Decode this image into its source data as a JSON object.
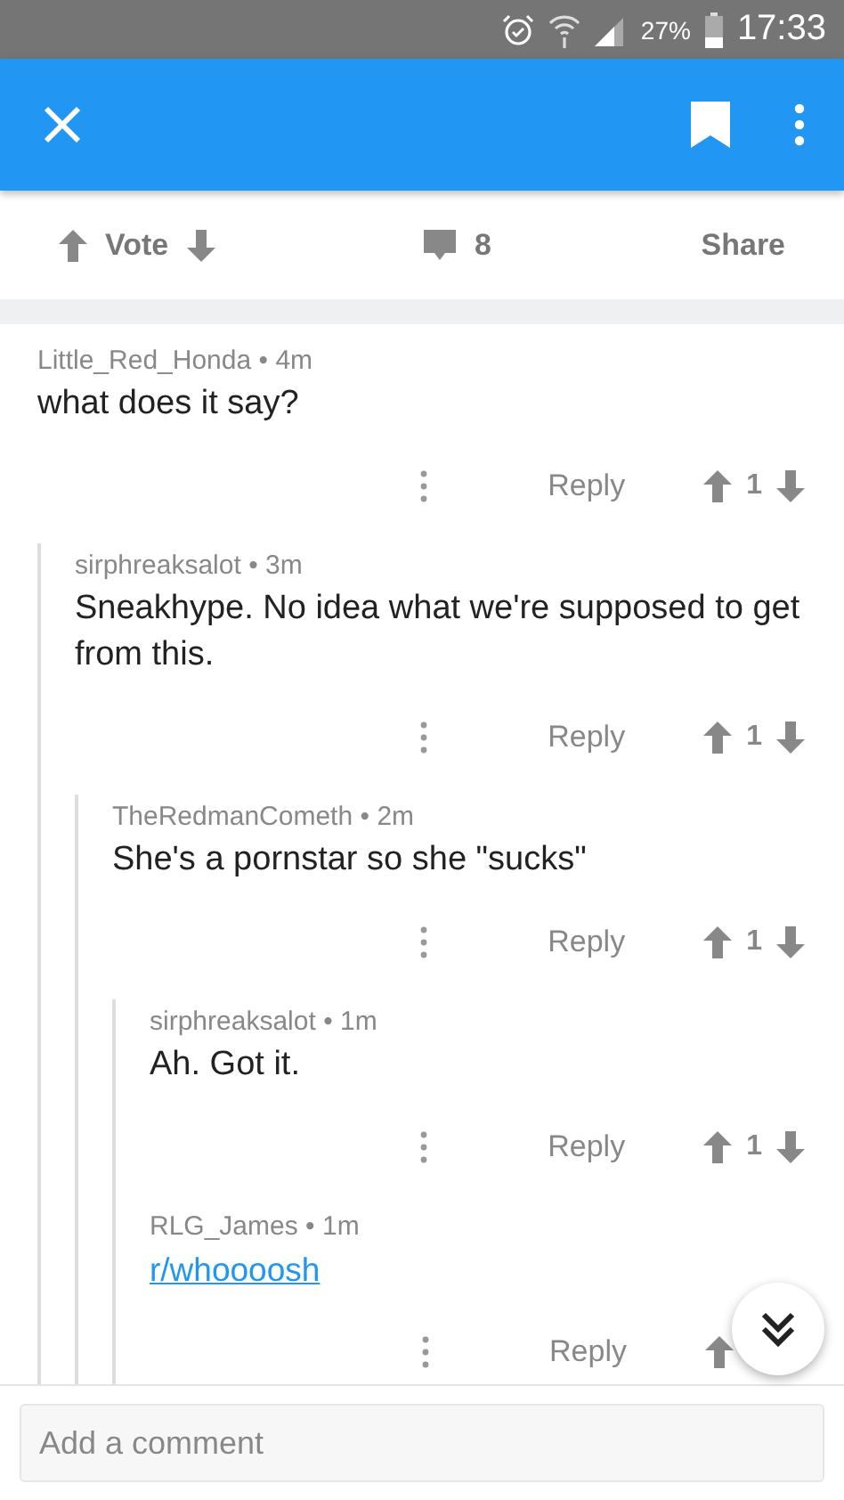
{
  "status_bar": {
    "battery": "27%",
    "time": "17:33"
  },
  "meta_separator": "•",
  "post_actions": {
    "vote_label": "Vote",
    "comment_count": "8",
    "share_label": "Share"
  },
  "comments": [
    {
      "author": "Little_Red_Honda",
      "age": "4m",
      "body": "what does it say?",
      "kind": "text",
      "reply_label": "Reply",
      "score": "1",
      "children": [
        {
          "author": "sirphreaksalot",
          "age": "3m",
          "body": "Sneakhype. No idea what we're supposed to get from this.",
          "kind": "text",
          "reply_label": "Reply",
          "score": "1",
          "children": [
            {
              "author": "TheRedmanCometh",
              "age": "2m",
              "body": "She's a pornstar so she \"sucks\"",
              "kind": "text",
              "reply_label": "Reply",
              "score": "1",
              "children": [
                {
                  "author": "sirphreaksalot",
                  "age": "1m",
                  "body": "Ah. Got it.",
                  "kind": "text",
                  "reply_label": "Reply",
                  "score": "1"
                },
                {
                  "author": "RLG_James",
                  "age": "1m",
                  "body": "r/whoooosh",
                  "kind": "link",
                  "reply_label": "Reply"
                }
              ]
            }
          ]
        }
      ]
    }
  ],
  "comment_input": {
    "placeholder": "Add a comment"
  }
}
